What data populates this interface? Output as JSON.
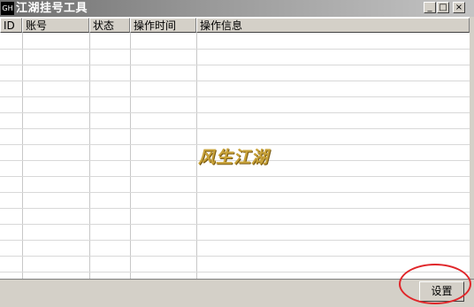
{
  "window": {
    "icon_text": "GH",
    "title": "江湖挂号工具",
    "min_symbol": "_",
    "max_symbol": "□",
    "close_symbol": "×"
  },
  "list": {
    "columns": [
      "ID",
      "账号",
      "状态",
      "操作时间",
      "操作信息"
    ],
    "rows": []
  },
  "watermark": "风生江湖",
  "buttons": {
    "settings": "设置"
  },
  "colors": {
    "annotation": "#e0262a",
    "watermark": "#c9a33a",
    "face": "#d4d0c8"
  }
}
